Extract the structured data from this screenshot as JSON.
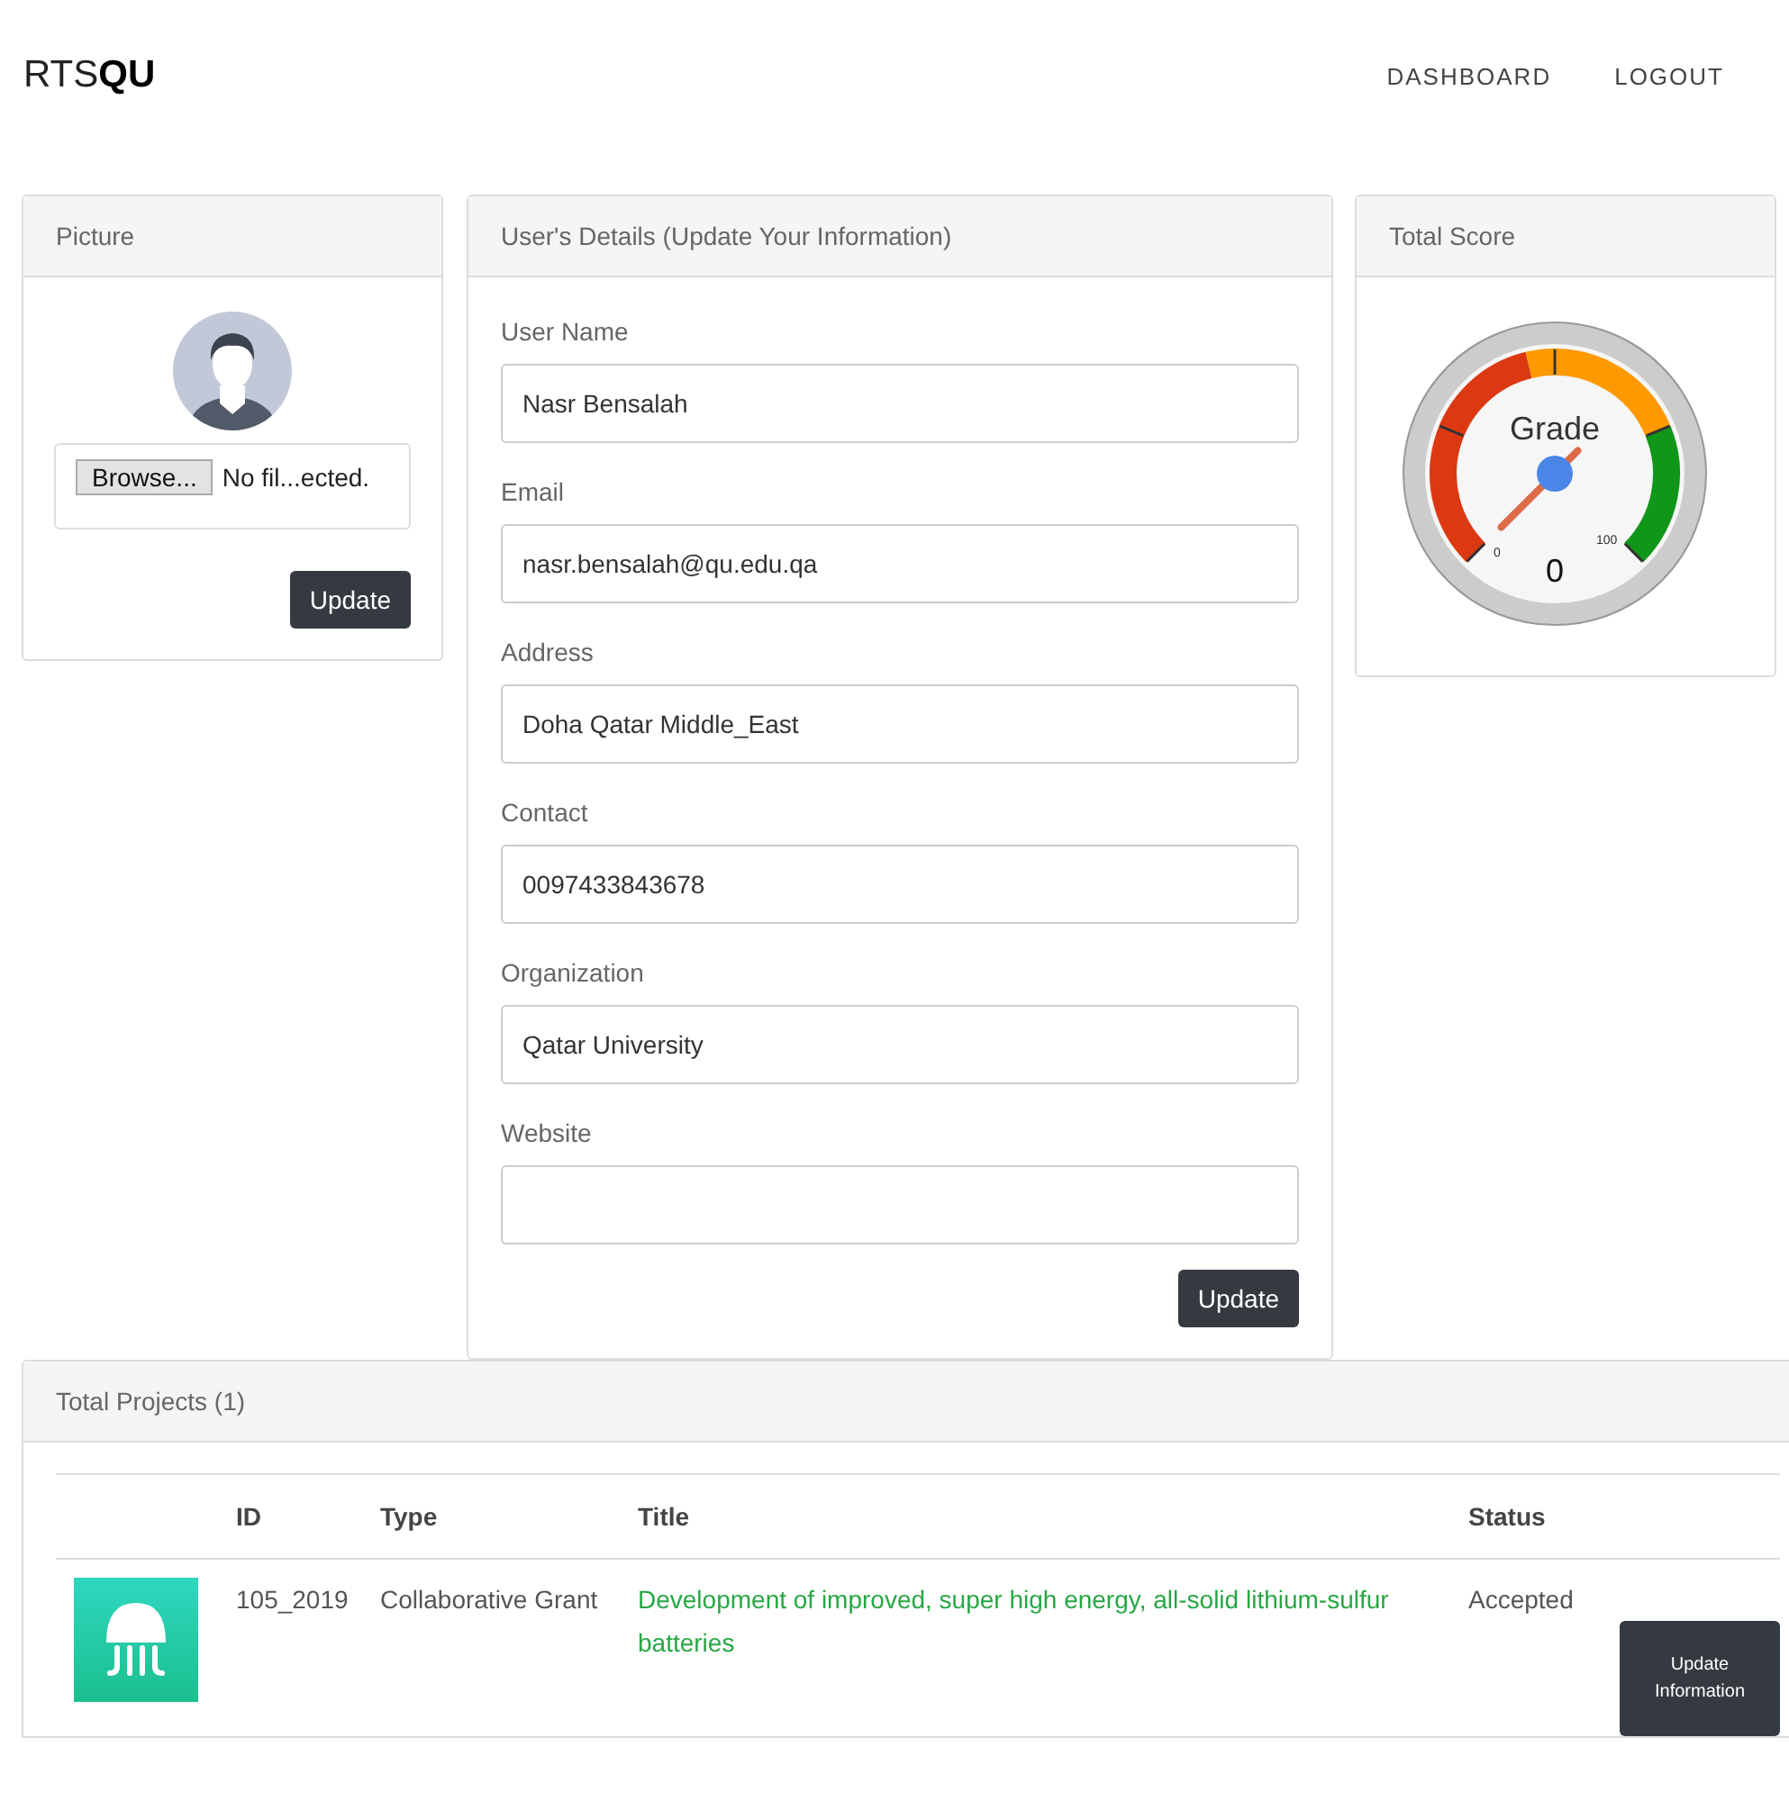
{
  "navbar": {
    "brand_light": "RTS",
    "brand_bold": "QU",
    "links": [
      "DASHBOARD",
      "LOGOUT"
    ]
  },
  "picture_card": {
    "title": "Picture",
    "file_input": {
      "button": "Browse...",
      "text": "No fil...ected."
    },
    "button": "Update"
  },
  "details_card": {
    "title": "User's Details (Update Your Information)",
    "fields": [
      {
        "label": "User Name",
        "value": "Nasr Bensalah"
      },
      {
        "label": "Email",
        "value": "nasr.bensalah@qu.edu.qa"
      },
      {
        "label": "Address",
        "value": "Doha Qatar Middle_East"
      },
      {
        "label": "Contact",
        "value": "0097433843678"
      },
      {
        "label": "Organization",
        "value": "Qatar University"
      },
      {
        "label": "Website"
      }
    ],
    "button": "Update"
  },
  "score_card": {
    "title": "Total Score",
    "gauge": {
      "label": "Grade",
      "min": "0",
      "max": "100",
      "reading": "0"
    }
  },
  "projects": {
    "title": "Total Projects (1)",
    "columns": [
      "ID",
      "Type",
      "Title",
      "Status"
    ],
    "rows": [
      {
        "id": "105_2019",
        "type": "Collaborative Grant",
        "title": "Development of improved, super high energy, all-solid lithium-sulfur batteries",
        "status": "Accepted",
        "action": "Update Information"
      }
    ]
  }
}
